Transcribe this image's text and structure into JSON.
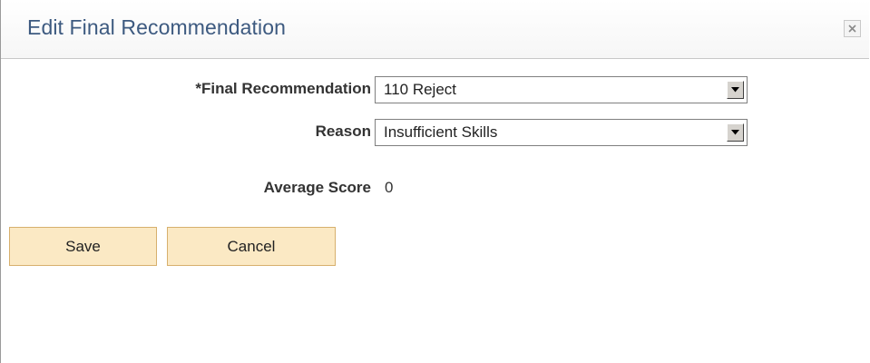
{
  "dialog": {
    "title": "Edit Final Recommendation",
    "close_icon": "close-icon"
  },
  "form": {
    "final_recommendation": {
      "label": "*Final Recommendation",
      "value": "110 Reject"
    },
    "reason": {
      "label": "Reason",
      "value": "Insufficient Skills"
    },
    "average_score": {
      "label": "Average Score",
      "value": "0"
    }
  },
  "buttons": {
    "save_label": "Save",
    "cancel_label": "Cancel"
  },
  "colors": {
    "title": "#3d5a80",
    "button_bg": "#fbe9c4",
    "button_border": "#d7b06d"
  }
}
